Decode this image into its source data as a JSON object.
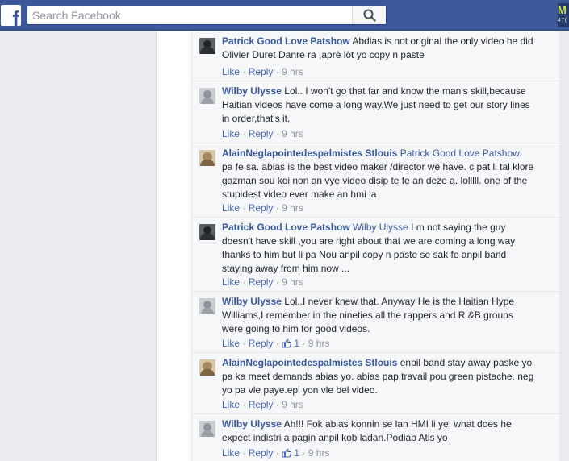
{
  "topbar": {
    "logo": "f",
    "search_placeholder": "Search Facebook",
    "corner_badge_top": "M",
    "corner_badge_bottom": "47("
  },
  "comments": [
    {
      "author": "Patrick Good Love Patshow",
      "mention": "",
      "text": "Abdias is not original the only video he did Olivier Duret Danre ra ,aprè lòt yo copy n paste",
      "like": "Like",
      "reply": "Reply",
      "likes": "",
      "time": "9 hrs",
      "avatar": "patrick-avatar"
    },
    {
      "author": "Wilby Ulysse",
      "mention": "",
      "text": "Lol.. I won't go that far and know the man's skill,because Haitian videos have come a long way.We just need to get our story lines in order,that's it.",
      "like": "Like",
      "reply": "Reply",
      "likes": "",
      "time": "9 hrs",
      "avatar": "wilby-avatar"
    },
    {
      "author": "AlainNeglapointedespalmistes Stlouis",
      "mention": "Patrick Good Love Patshow.",
      "text": "pa fe sa. abias is the best video maker /director we have. c pat li tal klore gazman sou koi non an vye video disip te fe an deze a. lolllll. one of the stupidest video ever make an hmi la",
      "like": "Like",
      "reply": "Reply",
      "likes": "",
      "time": "9 hrs",
      "avatar": "alain-avatar"
    },
    {
      "author": "Patrick Good Love Patshow",
      "mention": "Wilby Ulysse",
      "text": "I m not saying the guy doesn't have skill ,you are right about that we are coming a long way thanks to him but li pa Nou anpil copy n paste se sak fe anpil band staying away from him now ...",
      "like": "Like",
      "reply": "Reply",
      "likes": "",
      "time": "9 hrs",
      "avatar": "patrick-avatar"
    },
    {
      "author": "Wilby Ulysse",
      "mention": "",
      "text": "Lol..I never knew that. Anyway He is the Haitian Hype Williams,I remember in the nineties all the rappers and R &B groups were going to him for good videos.",
      "like": "Like",
      "reply": "Reply",
      "likes": "1",
      "time": "9 hrs",
      "avatar": "wilby-avatar"
    },
    {
      "author": "AlainNeglapointedespalmistes Stlouis",
      "mention": "",
      "text": "enpil band stay away paske yo pa ka meet demands abias yo. abias pap travail pou green pistache. neg yo pa vle paye.epi yon vle bel video.",
      "like": "Like",
      "reply": "Reply",
      "likes": "",
      "time": "9 hrs",
      "avatar": "alain-avatar"
    },
    {
      "author": "Wilby Ulysse",
      "mention": "",
      "text": "Ah!!! Fok abias konnin se lan HMI li ye, what does he expect indistri a pagin anpil kob ladan.Podiab Atis yo",
      "like": "Like",
      "reply": "Reply",
      "likes": "1",
      "time": "9 hrs",
      "avatar": "wilby-avatar"
    }
  ]
}
